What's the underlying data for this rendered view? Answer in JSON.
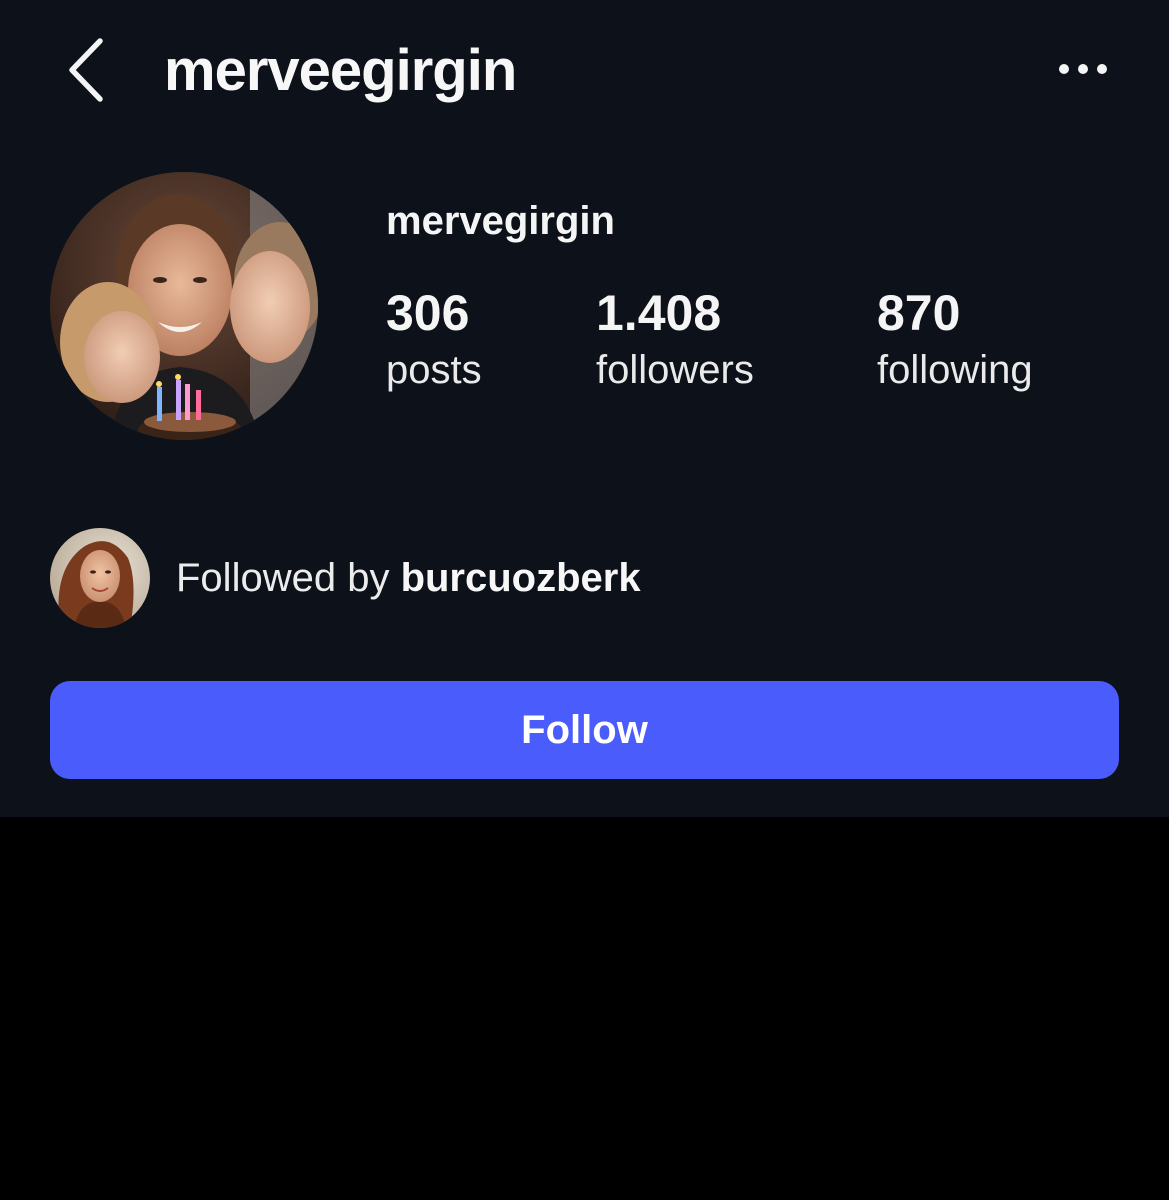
{
  "colors": {
    "panel_background": "#0c111a",
    "page_background": "#000000",
    "follow_button": "#4a5cfb",
    "text": "#f5f5f5"
  },
  "header": {
    "title": "merveegirgin",
    "back_icon": "chevron-left-icon",
    "more_icon": "more-horizontal-icon"
  },
  "profile": {
    "username": "mervegirgin",
    "stats": {
      "posts": {
        "value": "306",
        "label": "posts"
      },
      "followers": {
        "value": "1.408",
        "label": "followers"
      },
      "following": {
        "value": "870",
        "label": "following"
      }
    }
  },
  "mutual": {
    "prefix": "Followed by",
    "username": "burcuozberk"
  },
  "actions": {
    "follow_label": "Follow"
  }
}
